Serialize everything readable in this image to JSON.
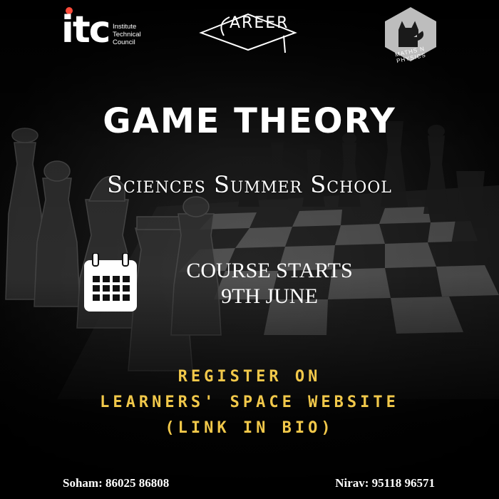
{
  "logos": {
    "itc": {
      "mark": "itc",
      "line1": "Institute",
      "line2": "Technical",
      "line3": "Council"
    },
    "career": {
      "text": "AREER"
    },
    "maths": {
      "text": "MATHS N PHYSICS"
    }
  },
  "title": "GAME THEORY",
  "subtitle": "Sciences Summer School",
  "course": {
    "line1": "COURSE STARTS",
    "line2": "9TH JUNE"
  },
  "register": {
    "line1": "REGISTER ON",
    "line2": "LEARNERS' SPACE WEBSITE",
    "line3": "(LINK IN BIO)"
  },
  "contacts": {
    "left": "Soham: 86025 86808",
    "right": "Nirav: 95118 96571"
  },
  "colors": {
    "accent": "#f1c84a",
    "text": "#ffffff",
    "background": "#111111"
  },
  "icons": {
    "calendar": "calendar-icon"
  }
}
